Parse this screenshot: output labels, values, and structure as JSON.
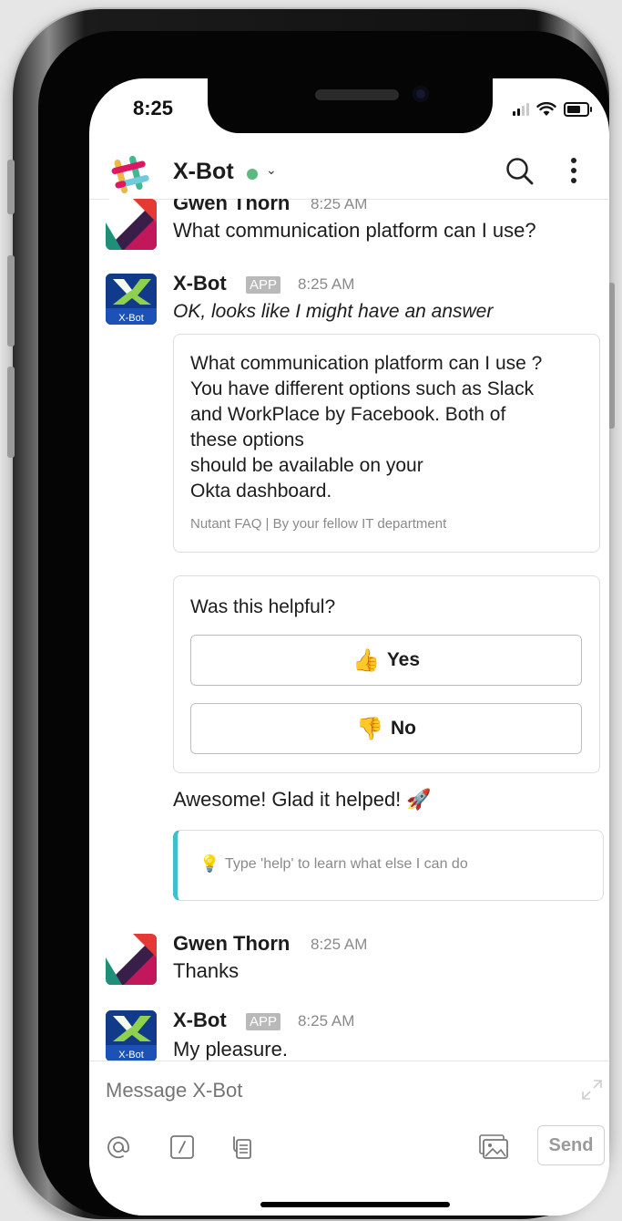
{
  "status_bar": {
    "time": "8:25"
  },
  "header": {
    "channel_name": "X-Bot",
    "status_color": "#5bb87f"
  },
  "messages": [
    {
      "sender": "Gwen Thorn",
      "time": "8:25 AM",
      "text": "What communication platform can I use?"
    },
    {
      "sender": "X-Bot",
      "tag": "APP",
      "time": "8:25 AM",
      "text": "OK, looks like I might have an answer",
      "avatar_label": "X-Bot"
    },
    {
      "sender": "Gwen Thorn",
      "time": "8:25 AM",
      "text": "Thanks"
    },
    {
      "sender": "X-Bot",
      "tag": "APP",
      "time": "8:25 AM",
      "text": "My pleasure.",
      "avatar_label": "X-Bot"
    }
  ],
  "answer_card": {
    "lines": [
      "What communication platform can I use ?",
      "You have different options such as Slack",
      "and WorkPlace by Facebook. Both of",
      "these options",
      "should be available on your",
      "Okta dashboard."
    ],
    "footer": "Nutant FAQ | By your fellow IT department"
  },
  "feedback": {
    "question": "Was this helpful?",
    "yes_label": "Yes",
    "no_label": "No",
    "yes_emoji": "👍",
    "no_emoji": "👎"
  },
  "followup": {
    "text": "Awesome! Glad it helped!",
    "emoji": "🚀"
  },
  "tip": {
    "icon": "💡",
    "text": "Type 'help' to learn what else I can do",
    "accent_color": "#3fbfc7"
  },
  "composer": {
    "placeholder": "Message X-Bot",
    "send_label": "Send"
  }
}
